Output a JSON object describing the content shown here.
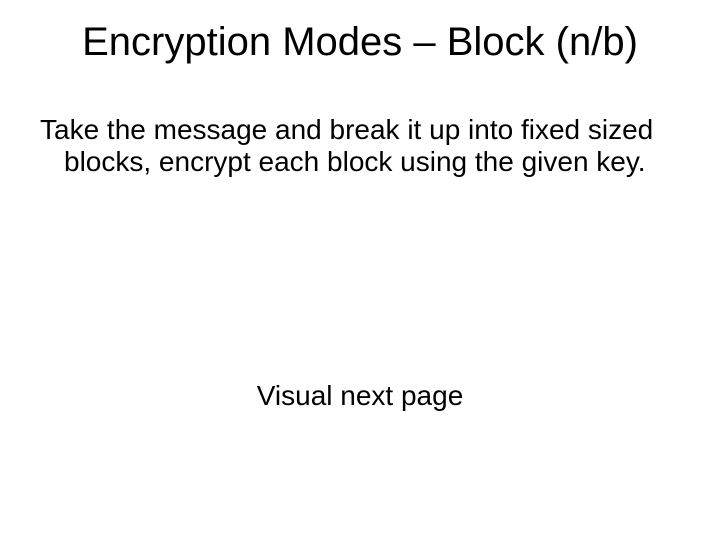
{
  "slide": {
    "title": "Encryption Modes – Block (n/b)",
    "body": "Take the message and break it up into fixed sized blocks, encrypt each block using the given key.",
    "footer": "Visual next page"
  }
}
